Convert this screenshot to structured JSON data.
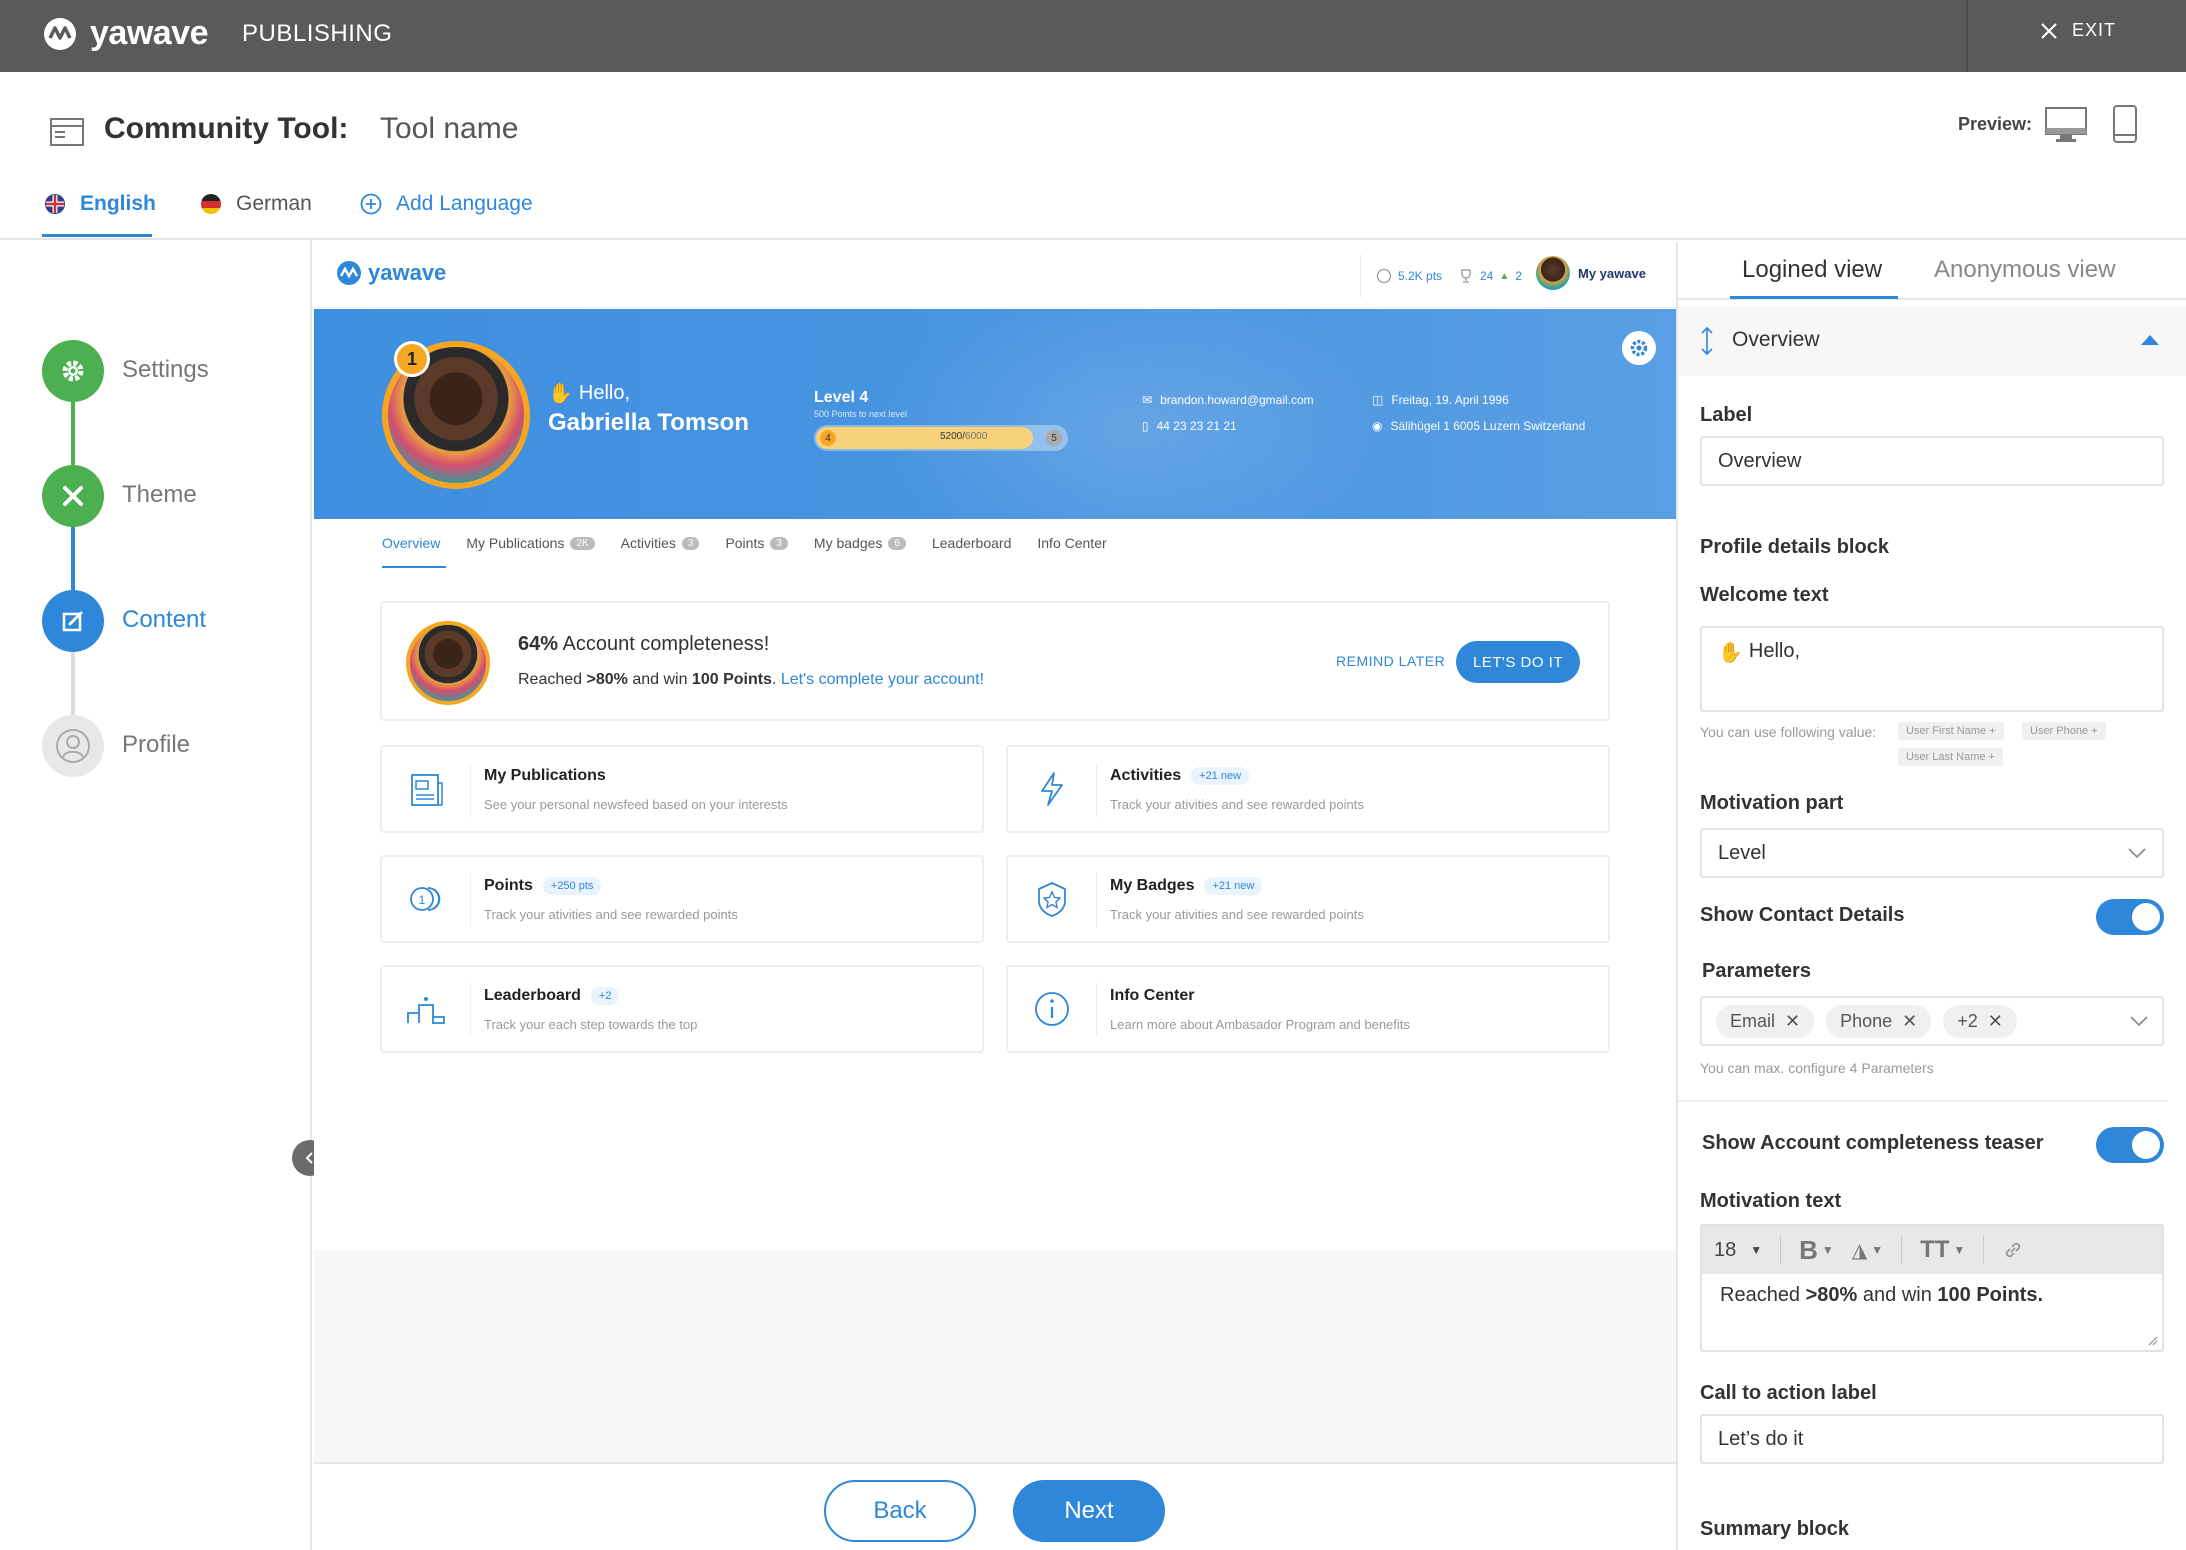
{
  "topbar": {
    "brand": "yawave",
    "section": "PUBLISHING",
    "exit_label": "EXIT"
  },
  "header": {
    "title": "Community Tool:",
    "tool_name": "Tool name",
    "preview_label": "Preview:"
  },
  "languages": {
    "english": "English",
    "german": "German",
    "add": "Add Language"
  },
  "steps": [
    {
      "label": "Settings"
    },
    {
      "label": "Theme"
    },
    {
      "label": "Content"
    },
    {
      "label": "Profile"
    }
  ],
  "preview": {
    "logo": "yawave",
    "points": "5.2K pts",
    "trophy": "24",
    "trophy_up": "2",
    "my_yawave": "My yawave",
    "hero": {
      "rank": "1",
      "hello": "Hello,",
      "name": "Gabriella Tomson",
      "level": "Level 4",
      "level_sub": "500 Points to next level",
      "level_from": "4",
      "level_to": "5",
      "progress_text": "5200/",
      "progress_total": "6000",
      "progress_fraction": 0.867,
      "email": "brandon.howard@gmail.com",
      "phone": "44 23 23 21 21",
      "birthday": "Freitag, 19. April 1996",
      "address": "Sälihügel 1 6005 Luzern Switzerland"
    },
    "tabs": [
      {
        "label": "Overview",
        "count": ""
      },
      {
        "label": "My Publications",
        "count": "2K"
      },
      {
        "label": "Activities",
        "count": "3"
      },
      {
        "label": "Points",
        "count": "3"
      },
      {
        "label": "My badges",
        "count": "6"
      },
      {
        "label": "Leaderboard",
        "count": ""
      },
      {
        "label": "Info Center",
        "count": ""
      }
    ],
    "completeness": {
      "percent": "64%",
      "title_rest": " Account completeness!",
      "line_a": "Reached ",
      "line_b": ">80%",
      "line_c": " and win ",
      "line_d": "100 Points",
      "line_e": ". ",
      "link": "Let's complete your account!",
      "remind": "REMIND LATER",
      "cta": "LET'S DO IT"
    },
    "cards": [
      {
        "title": "My Publications",
        "pill": "",
        "sub": "See your personal newsfeed based on your interests"
      },
      {
        "title": "Activities",
        "pill": "+21 new",
        "sub": "Track your ativities and see rewarded points"
      },
      {
        "title": "Points",
        "pill": "+250 pts",
        "sub": "Track your ativities and see rewarded points"
      },
      {
        "title": "My Badges",
        "pill": "+21 new",
        "sub": "Track your ativities and see rewarded points"
      },
      {
        "title": "Leaderboard",
        "pill": "+2",
        "sub": "Track your each step towards the top"
      },
      {
        "title": "Info Center",
        "pill": "",
        "sub": "Learn more about Ambasador Program and benefits"
      }
    ]
  },
  "footer": {
    "back": "Back",
    "next": "Next"
  },
  "right_panel": {
    "tab_logined": "Logined view",
    "tab_anonymous": "Anonymous view",
    "section_title": "Overview",
    "label_label": "Label",
    "label_value": "Overview",
    "profile_block": "Profile details block",
    "welcome_label": "Welcome text",
    "welcome_value": "Hello,",
    "welcome_hint": "You can use following value:",
    "hint_chips": [
      "User First Name",
      "User Phone",
      "User Last Name"
    ],
    "motivation_label": "Motivation part",
    "motivation_value": "Level",
    "show_contact": "Show Contact Details",
    "show_contact_on": true,
    "parameters_label": "Parameters",
    "parameters": [
      "Email",
      "Phone",
      "+2"
    ],
    "parameters_hint": "You can max. configure 4 Parameters",
    "show_teaser": "Show Account completeness teaser",
    "show_teaser_on": true,
    "motivation_text_label": "Motivation text",
    "font_size": "18",
    "mt_a": "Reached ",
    "mt_b": ">80%",
    "mt_c": " and win ",
    "mt_d": "100 Points.",
    "cta_label": "Call to action label",
    "cta_value": "Let’s do it",
    "summary_block": "Summary block"
  },
  "colors": {
    "accent": "#2e87d8",
    "success": "#4caf50",
    "topbar": "#5a5a5a",
    "hero": "#3f8fe0"
  }
}
